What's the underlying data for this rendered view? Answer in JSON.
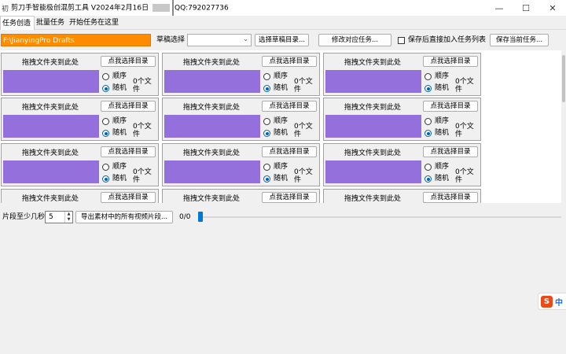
{
  "window": {
    "title_prefix": "剪刀手智能极创混剪工具 V2024年2月16日",
    "title_suffix": "QQ:792027736",
    "minimize": "—",
    "maximize": "☐",
    "close": "✕"
  },
  "menu": {
    "items": [
      {
        "label": "任务创造"
      },
      {
        "label": "批量任务"
      },
      {
        "label": "开始任务在这里"
      }
    ]
  },
  "toolbar": {
    "path_value": "F:\\JianyingPro Drafts",
    "draft_label": "草稿选择",
    "draft_select_value": "",
    "choose_dir_btn": "选择草稿目录...",
    "edit_task_btn": "修改对应任务...",
    "save_add_label": "保存后直接加入任务列表",
    "save_task_btn": "保存当前任务..."
  },
  "cell_text": {
    "drop_label": "拖拽文件夹到此处",
    "pick_btn": "点我选择目录",
    "order_label": "顺序",
    "random_label": "随机",
    "count_label": "0个文件"
  },
  "colors": {
    "swatch": "#9370db",
    "path_bg": "#ff8c00",
    "accent": "#0078d7"
  },
  "bottom": {
    "min_seconds_label": "片段至少几秒",
    "min_seconds_value": "5",
    "export_btn": "导出素材中的所有视频片段...",
    "progress_text": "0/0"
  },
  "ime": {
    "logo": "S",
    "mode": "中"
  }
}
